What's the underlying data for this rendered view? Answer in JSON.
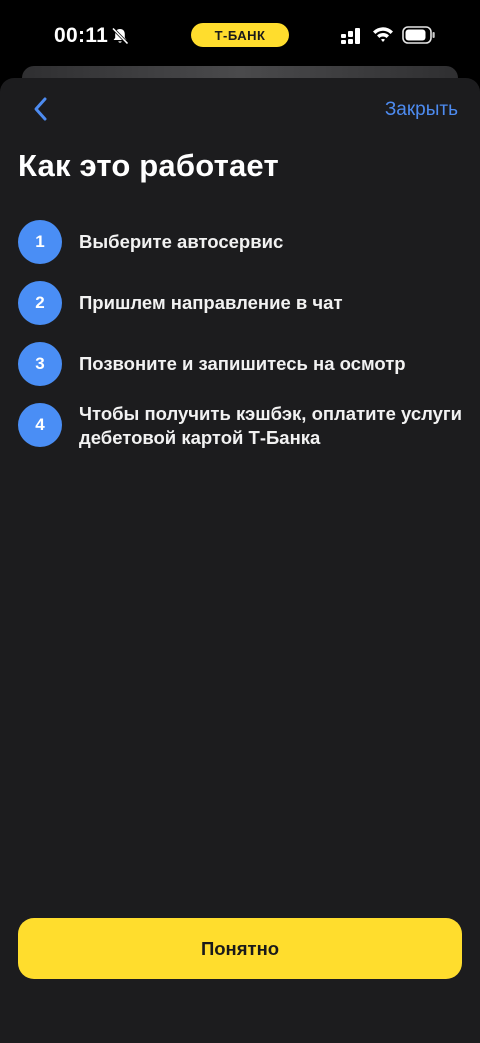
{
  "status_bar": {
    "time": "00:11",
    "brand_pill": "Т-БАНК",
    "icons": [
      "bell-slash-icon",
      "signal-icon",
      "wifi-icon",
      "battery-icon"
    ]
  },
  "header": {
    "back_icon": "chevron-left-icon",
    "close_label": "Закрыть"
  },
  "title": "Как это работает",
  "steps": [
    {
      "number": "1",
      "text": "Выберите автосервис"
    },
    {
      "number": "2",
      "text": "Пришлем направление в чат"
    },
    {
      "number": "3",
      "text": "Позвоните и запишитесь на осмотр"
    },
    {
      "number": "4",
      "text": "Чтобы получить кэшбэк, оплатите услуги дебетовой картой Т-Банка"
    }
  ],
  "primary_button": {
    "label": "Понятно"
  },
  "colors": {
    "accent_yellow": "#FFDD2D",
    "accent_blue": "#4a8ef5",
    "link_blue": "#4d8bf0",
    "sheet_bg": "#1c1c1e"
  }
}
